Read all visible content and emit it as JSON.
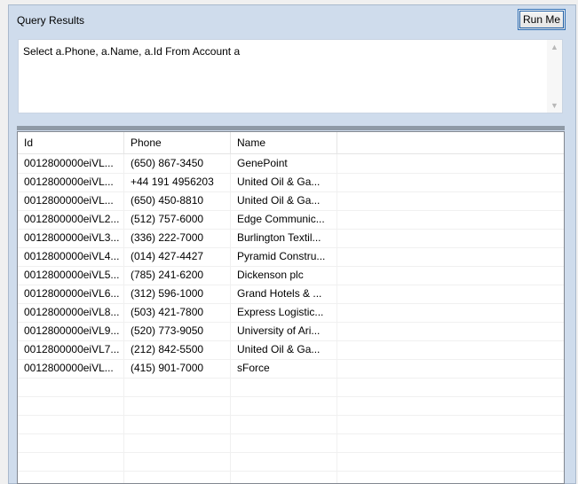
{
  "header": {
    "title": "Query Results",
    "run_label": "Run Me"
  },
  "query": {
    "text": "Select a.Phone, a.Name, a.Id From Account a"
  },
  "grid": {
    "columns": [
      "Id",
      "Phone",
      "Name"
    ],
    "rows": [
      [
        "0012800000eiVL...",
        "(650) 867-3450",
        "GenePoint"
      ],
      [
        "0012800000eiVL...",
        "+44 191 4956203",
        "United Oil & Ga..."
      ],
      [
        "0012800000eiVL...",
        "(650) 450-8810",
        "United Oil & Ga..."
      ],
      [
        "0012800000eiVL2...",
        "(512) 757-6000",
        "Edge Communic..."
      ],
      [
        "0012800000eiVL3...",
        "(336) 222-7000",
        "Burlington Textil..."
      ],
      [
        "0012800000eiVL4...",
        "(014) 427-4427",
        "Pyramid Constru..."
      ],
      [
        "0012800000eiVL5...",
        "(785) 241-6200",
        "Dickenson plc"
      ],
      [
        "0012800000eiVL6...",
        "(312) 596-1000",
        "Grand Hotels & ..."
      ],
      [
        "0012800000eiVL8...",
        "(503) 421-7800",
        "Express Logistic..."
      ],
      [
        "0012800000eiVL9...",
        "(520) 773-9050",
        "University of Ari..."
      ],
      [
        "0012800000eiVL7...",
        "(212) 842-5500",
        "United Oil & Ga..."
      ],
      [
        "0012800000eiVL...",
        "(415) 901-7000",
        "sForce"
      ]
    ]
  }
}
